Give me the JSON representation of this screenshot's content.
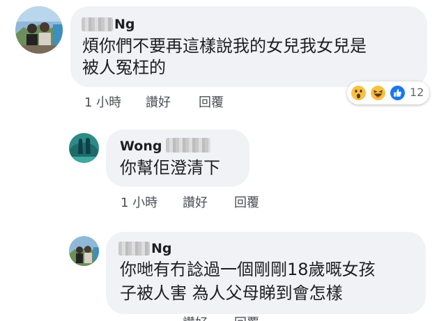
{
  "comments": [
    {
      "author_suffix": "Ng",
      "text_lines": [
        "煩你們不要再這樣說我的女兒我女兒是",
        "被人冤枉的"
      ],
      "time": "1 小時",
      "like_label": "讚好",
      "reply_label": "回覆",
      "reactions": {
        "icons": [
          "wow-icon",
          "haha-icon",
          "like-icon"
        ],
        "count": "12"
      }
    },
    {
      "author_prefix": "Wong",
      "text_lines": [
        "你幫佢澄清下"
      ],
      "time": "1 小時",
      "like_label": "讚好",
      "reply_label": "回覆"
    },
    {
      "author_suffix": "Ng",
      "text_lines": [
        "你哋有冇諗過一個剛剛18歲嘅女孩",
        "子被人害 為人父母睇到會怎樣"
      ],
      "like_label": "讚好",
      "reply_label": "回覆"
    }
  ],
  "colors": {
    "bubble": "#f0f2f5",
    "link": "#4b4f56",
    "like_blue": "#1877f2",
    "emoji_yellow": "#f7c244"
  }
}
